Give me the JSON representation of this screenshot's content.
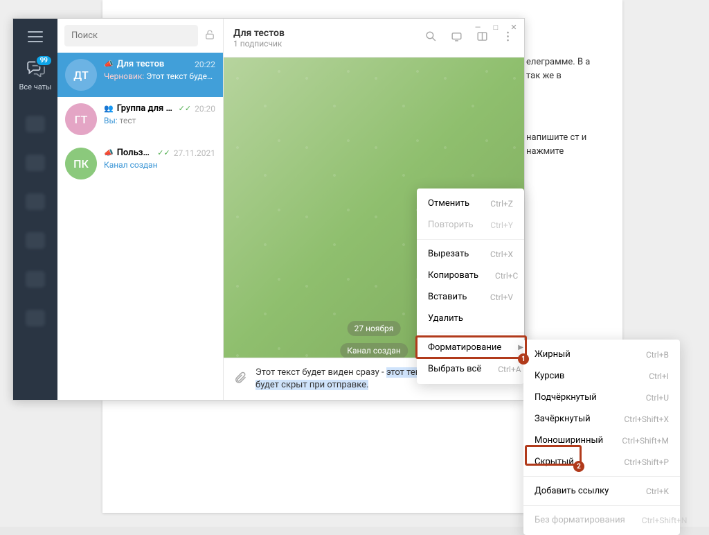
{
  "bgText": {
    "p1": "елеграмме. В а так же в",
    "p2": "напишите ст и нажмите"
  },
  "window": {
    "min": "—",
    "max": "□",
    "close": "✕"
  },
  "farLeft": {
    "badge": "99",
    "allChats": "Все чаты"
  },
  "search": {
    "placeholder": "Поиск"
  },
  "chats": [
    {
      "avatar": "ДТ",
      "avatarBg": "#6cb3e4",
      "title": "Для тестов",
      "time": "20:22",
      "draftLabel": "Черновик:",
      "preview": " Этот текст будет …",
      "active": true,
      "icon": "📣"
    },
    {
      "avatar": "ГТ",
      "avatarBg": "#e4a5c5",
      "title": "Группа для те…",
      "time": "20:20",
      "youLabel": "Вы:",
      "preview": " тест",
      "checks": "✓✓",
      "icon": "👥"
    },
    {
      "avatar": "ПК",
      "avatarBg": "#8bc97c",
      "title": "Пользно…",
      "time": "27.11.2021",
      "linkPreview": "Канал создан",
      "checks": "✓✓",
      "icon": "📣"
    }
  ],
  "chatHeader": {
    "title": "Для тестов",
    "subtitle": "1 подписчик"
  },
  "dateChip": "27 ноября",
  "serviceMsg": "Канал создан",
  "input": {
    "textBefore": "Этот текст будет виден сразу - ",
    "textSel": "этот текст будет скрыт при отправке."
  },
  "menu1": [
    {
      "label": "Отменить",
      "shortcut": "Ctrl+Z"
    },
    {
      "label": "Повторить",
      "shortcut": "Ctrl+Y",
      "disabled": true
    },
    {
      "sep": true
    },
    {
      "label": "Вырезать",
      "shortcut": "Ctrl+X"
    },
    {
      "label": "Копировать",
      "shortcut": "Ctrl+C"
    },
    {
      "label": "Вставить",
      "shortcut": "Ctrl+V"
    },
    {
      "label": "Удалить"
    },
    {
      "sep": true
    },
    {
      "label": "Форматирование",
      "submenu": true
    },
    {
      "label": "Выбрать всё",
      "shortcut": "Ctrl+A"
    }
  ],
  "menu2": [
    {
      "label": "Жирный",
      "shortcut": "Ctrl+B"
    },
    {
      "label": "Курсив",
      "shortcut": "Ctrl+I"
    },
    {
      "label": "Подчёркнутый",
      "shortcut": "Ctrl+U"
    },
    {
      "label": "Зачёркнутый",
      "shortcut": "Ctrl+Shift+X"
    },
    {
      "label": "Моноширинный",
      "shortcut": "Ctrl+Shift+M"
    },
    {
      "label": "Скрытый",
      "shortcut": "Ctrl+Shift+P"
    },
    {
      "sep": true
    },
    {
      "label": "Добавить ссылку",
      "shortcut": "Ctrl+K"
    },
    {
      "sep": true
    },
    {
      "label": "Без форматирования",
      "shortcut": "Ctrl+Shift+N",
      "disabled": true
    }
  ],
  "annotations": {
    "n1": "1",
    "n2": "2"
  }
}
